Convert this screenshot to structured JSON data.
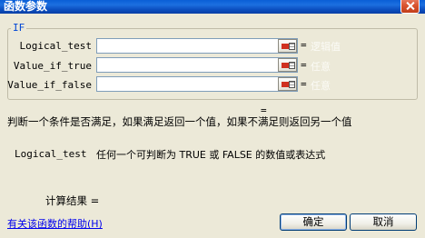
{
  "window": {
    "title": "函数参数"
  },
  "group": {
    "label": "IF"
  },
  "args": [
    {
      "label": "Logical_test",
      "value": "",
      "equals": "=",
      "hint": "逻辑值"
    },
    {
      "label": "Value_if_true",
      "value": "",
      "equals": "=",
      "hint": "任意"
    },
    {
      "label": "Value_if_false",
      "value": "",
      "equals": "=",
      "hint": "任意"
    }
  ],
  "result_equals": "=",
  "description": "判断一个条件是否满足，如果满足返回一个值，如果不满足则返回另一个值",
  "arg_help": {
    "name": "Logical_test",
    "text": "任何一个可判断为 TRUE 或 FALSE 的数值或表达式"
  },
  "calc": {
    "label": "计算结果 ="
  },
  "help_link": "有关该函数的帮助(H)",
  "buttons": {
    "ok": "确定",
    "cancel": "取消"
  }
}
